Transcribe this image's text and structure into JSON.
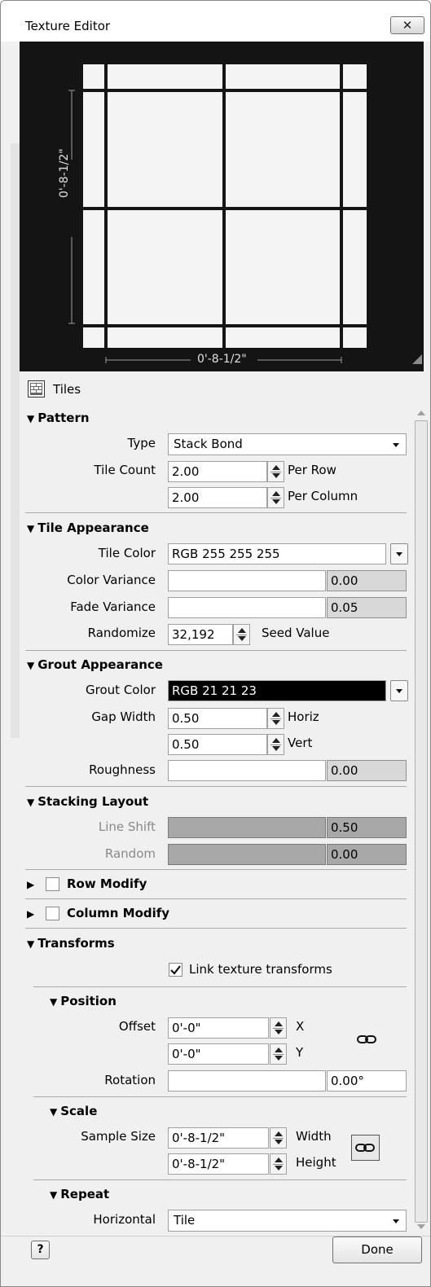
{
  "window": {
    "title": "Texture Editor",
    "close_label": "✕"
  },
  "preview": {
    "height_dim": "0'-8-1/2\"",
    "width_dim": "0'-8-1/2\""
  },
  "texture_name": "Tiles",
  "pattern": {
    "header": "Pattern",
    "type_label": "Type",
    "type_value": "Stack Bond",
    "tile_count_label": "Tile Count",
    "per_row_value": "2.00",
    "per_row_label": "Per Row",
    "per_column_value": "2.00",
    "per_column_label": "Per Column"
  },
  "tile_appearance": {
    "header": "Tile Appearance",
    "tile_color_label": "Tile Color",
    "tile_color_value": "RGB 255 255 255",
    "color_variance_label": "Color Variance",
    "color_variance_value": "0.00",
    "fade_variance_label": "Fade Variance",
    "fade_variance_value": "0.05",
    "randomize_label": "Randomize",
    "randomize_value": "32,192",
    "seed_label": "Seed Value"
  },
  "grout_appearance": {
    "header": "Grout Appearance",
    "grout_color_label": "Grout Color",
    "grout_color_value": "RGB 21 21 23",
    "gap_width_label": "Gap Width",
    "horiz_value": "0.50",
    "horiz_label": "Horiz",
    "vert_value": "0.50",
    "vert_label": "Vert",
    "roughness_label": "Roughness",
    "roughness_value": "0.00"
  },
  "stacking_layout": {
    "header": "Stacking Layout",
    "line_shift_label": "Line Shift",
    "line_shift_value": "0.50",
    "random_label": "Random",
    "random_value": "0.00"
  },
  "row_modify": {
    "header": "Row Modify"
  },
  "column_modify": {
    "header": "Column Modify"
  },
  "transforms": {
    "header": "Transforms",
    "link_label": "Link texture transforms"
  },
  "position": {
    "header": "Position",
    "offset_label": "Offset",
    "x_value": "0'-0\"",
    "x_label": "X",
    "y_value": "0'-0\"",
    "y_label": "Y",
    "rotation_label": "Rotation",
    "rotation_value": "0.00°"
  },
  "scale": {
    "header": "Scale",
    "sample_size_label": "Sample Size",
    "width_value": "0'-8-1/2\"",
    "width_label": "Width",
    "height_value": "0'-8-1/2\"",
    "height_label": "Height"
  },
  "repeat": {
    "header": "Repeat",
    "horizontal_label": "Horizontal",
    "horizontal_value": "Tile"
  },
  "footer": {
    "help_label": "?",
    "done_label": "Done"
  },
  "colors": {
    "grout": "#151517",
    "preview_bg": "#141414"
  }
}
